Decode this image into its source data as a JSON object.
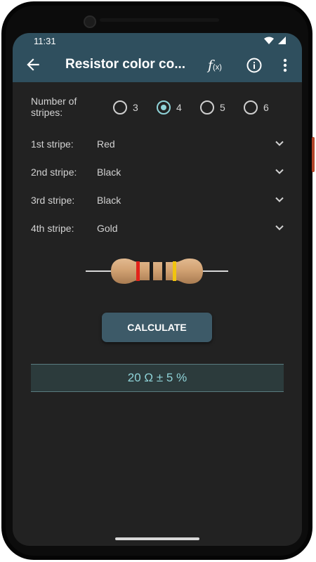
{
  "status_bar": {
    "time": "11:31"
  },
  "toolbar": {
    "title": "Resistor color co...",
    "fx_main": "f",
    "fx_sub": "(x)"
  },
  "stripes_count": {
    "label_line1": "Number of",
    "label_line2": "stripes:",
    "options": [
      "3",
      "4",
      "5",
      "6"
    ],
    "selected": "4"
  },
  "stripes": [
    {
      "label": "1st stripe:",
      "value": "Red"
    },
    {
      "label": "2nd stripe:",
      "value": "Black"
    },
    {
      "label": "3rd stripe:",
      "value": "Black"
    },
    {
      "label": "4th stripe:",
      "value": "Gold"
    }
  ],
  "resistor_band_colors": [
    "#e2231a",
    "#1b1b1b",
    "#1b1b1b",
    "#f1c40f"
  ],
  "calculate_label": "CALCULATE",
  "result": "20 Ω ± 5 %",
  "colors": {
    "toolbar": "#2f4f5e",
    "background": "#222222",
    "accent": "#8fd3d8",
    "button": "#3d5a68"
  }
}
